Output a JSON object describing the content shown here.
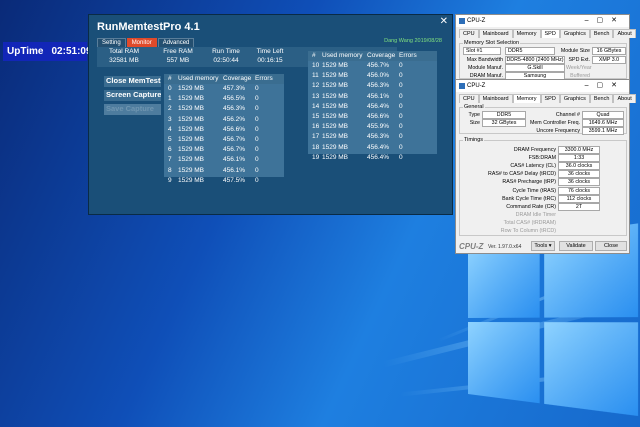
{
  "uptime": {
    "label": "UpTime",
    "value": "02:51:09"
  },
  "rmt": {
    "title": "RunMemtestPro 4.1",
    "tabs": [
      "Setting",
      "Monitor",
      "Advanced"
    ],
    "author": "Dang Wang 2019/08/28",
    "summary": {
      "headers": [
        "Total RAM",
        "Free RAM",
        "Run Time",
        "Time Left"
      ],
      "values": [
        "32581 MB",
        "557 MB",
        "02:50:44",
        "00:16:15"
      ]
    },
    "buttons": [
      "Close MemTest",
      "Screen Capture",
      "Save Capture"
    ],
    "grid_headers": [
      "#",
      "Used memory",
      "Coverage",
      "Errors"
    ],
    "rows_left": [
      [
        "0",
        "1529 MB",
        "457.3%",
        "0"
      ],
      [
        "1",
        "1529 MB",
        "456.5%",
        "0"
      ],
      [
        "2",
        "1529 MB",
        "456.3%",
        "0"
      ],
      [
        "3",
        "1529 MB",
        "456.2%",
        "0"
      ],
      [
        "4",
        "1529 MB",
        "456.6%",
        "0"
      ],
      [
        "5",
        "1529 MB",
        "456.7%",
        "0"
      ],
      [
        "6",
        "1529 MB",
        "456.7%",
        "0"
      ],
      [
        "7",
        "1529 MB",
        "456.1%",
        "0"
      ],
      [
        "8",
        "1529 MB",
        "456.1%",
        "0"
      ],
      [
        "9",
        "1529 MB",
        "457.5%",
        "0"
      ]
    ],
    "rows_right": [
      [
        "10",
        "1529 MB",
        "456.7%",
        "0"
      ],
      [
        "11",
        "1529 MB",
        "456.0%",
        "0"
      ],
      [
        "12",
        "1529 MB",
        "456.3%",
        "0"
      ],
      [
        "13",
        "1529 MB",
        "456.1%",
        "0"
      ],
      [
        "14",
        "1529 MB",
        "456.4%",
        "0"
      ],
      [
        "15",
        "1529 MB",
        "456.6%",
        "0"
      ],
      [
        "16",
        "1529 MB",
        "455.9%",
        "0"
      ],
      [
        "17",
        "1529 MB",
        "456.3%",
        "0"
      ],
      [
        "18",
        "1529 MB",
        "456.4%",
        "0"
      ],
      [
        "19",
        "1529 MB",
        "456.4%",
        "0"
      ]
    ]
  },
  "cpuz_spd": {
    "title": "CPU-Z",
    "tabs": [
      "CPU",
      "Mainboard",
      "Memory",
      "SPD",
      "Graphics",
      "Bench",
      "About"
    ],
    "group": "Memory Slot Selection",
    "slot": "Slot #1",
    "type": "DDR5",
    "module_size_label": "Module Size",
    "module_size": "16 GBytes",
    "max_bw_label": "Max Bandwidth",
    "max_bw": "DDR5-4800 (2400 MHz)",
    "spd_ext_label": "SPD Ext.",
    "spd_ext": "XMP 3.0",
    "manuf_label": "Module Manuf.",
    "manuf": "G.Skill",
    "weeks_label": "Week/Year",
    "dram_manuf_label": "DRAM Manuf.",
    "dram_manuf": "Samsung",
    "buffered_label": "Buffered"
  },
  "cpuz_mem": {
    "title": "CPU-Z",
    "tabs": [
      "CPU",
      "Mainboard",
      "Memory",
      "SPD",
      "Graphics",
      "Bench",
      "About"
    ],
    "general_label": "General",
    "type_label": "Type",
    "type": "DDR5",
    "channel_label": "Channel #",
    "channel": "Quad",
    "size_label": "Size",
    "size": "32 GBytes",
    "mcf_label": "Mem Controller Freq.",
    "mcf": "1649.6 MHz",
    "uncore_label": "Uncore Frequency",
    "uncore": "3599.1 MHz",
    "timings_label": "Timings",
    "timings": [
      {
        "label": "DRAM Frequency",
        "value": "3300.0 MHz",
        "dim": false
      },
      {
        "label": "FSB:DRAM",
        "value": "1:33",
        "dim": false
      },
      {
        "label": "CAS# Latency (CL)",
        "value": "36.0 clocks",
        "dim": false
      },
      {
        "label": "RAS# to CAS# Delay (tRCD)",
        "value": "36 clocks",
        "dim": false
      },
      {
        "label": "RAS# Precharge (tRP)",
        "value": "36 clocks",
        "dim": false
      },
      {
        "label": "Cycle Time (tRAS)",
        "value": "76 clocks",
        "dim": false
      },
      {
        "label": "Bank Cycle Time (tRC)",
        "value": "112 clocks",
        "dim": false
      },
      {
        "label": "Command Rate (CR)",
        "value": "2T",
        "dim": false
      },
      {
        "label": "DRAM Idle Timer",
        "value": "",
        "dim": true
      },
      {
        "label": "Total CAS# (tRDRAM)",
        "value": "",
        "dim": true
      },
      {
        "label": "Row To Column (tRCD)",
        "value": "",
        "dim": true
      }
    ],
    "logo": "CPU-Z",
    "version": "Ver. 1.97.0.x64",
    "tools": "Tools",
    "validate": "Validate",
    "close": "Close"
  }
}
